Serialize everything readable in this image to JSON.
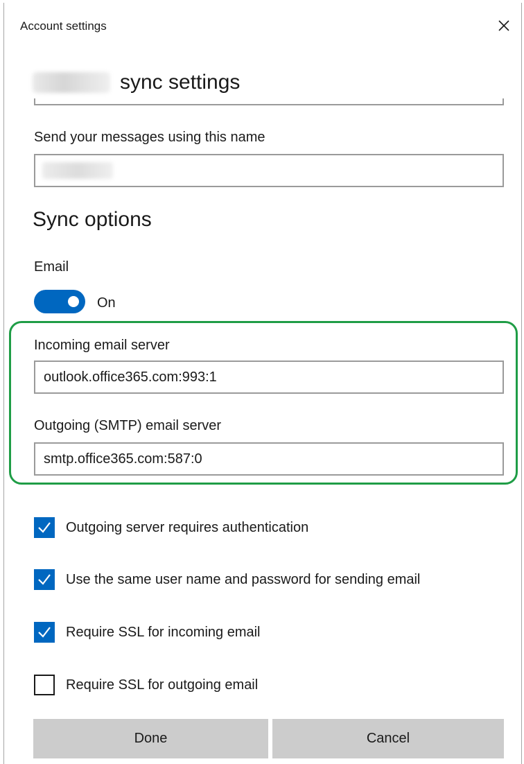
{
  "dialog": {
    "title": "Account settings",
    "close_icon": "close-icon"
  },
  "account": {
    "header_suffix": "sync settings"
  },
  "display_name": {
    "label": "Send your messages using this name"
  },
  "sync_options": {
    "title": "Sync options",
    "email_label": "Email",
    "email_toggle_state": "On",
    "email_toggle_on": true
  },
  "servers": {
    "incoming_label": "Incoming email server",
    "incoming_value": "outlook.office365.com:993:1",
    "outgoing_label": "Outgoing (SMTP) email server",
    "outgoing_value": "smtp.office365.com:587:0",
    "highlight_color": "#1f9d46"
  },
  "options": [
    {
      "label": "Outgoing server requires authentication",
      "checked": true
    },
    {
      "label": "Use the same user name and password for sending email",
      "checked": true
    },
    {
      "label": "Require SSL for incoming email",
      "checked": true
    },
    {
      "label": "Require SSL for outgoing email",
      "checked": false
    }
  ],
  "buttons": {
    "done": "Done",
    "cancel": "Cancel"
  },
  "colors": {
    "accent": "#0067c0",
    "button_bg": "#cccccc",
    "field_border": "#9a9a9a"
  }
}
